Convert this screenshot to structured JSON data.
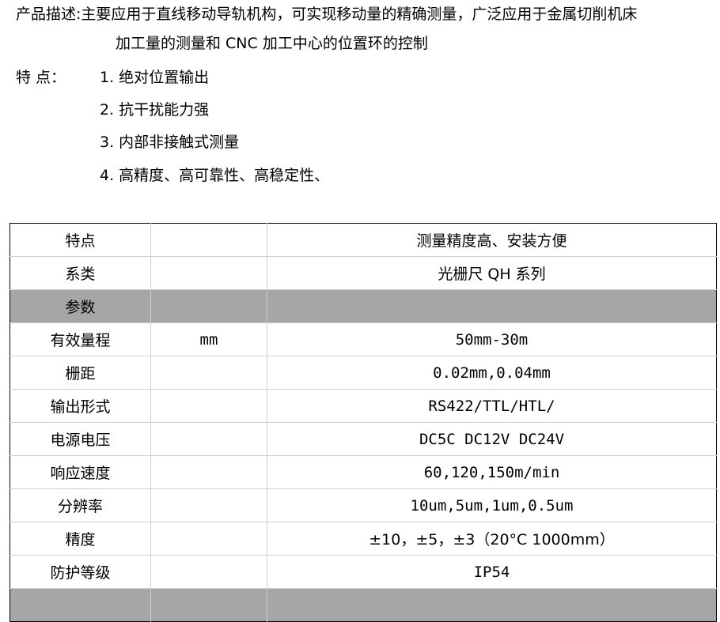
{
  "description": {
    "line1": "产品描述:主要应用于直线移动导轨机构，可实现移动量的精确测量，广泛应用于金属切削机床",
    "line2": "加工量的测量和 CNC 加工中心的位置环的控制"
  },
  "features": {
    "label": "特    点：",
    "items": [
      "1. 绝对位置输出",
      "2. 抗干扰能力强",
      "3. 内部非接触式测量",
      "4. 高精度、高可靠性、高稳定性、"
    ]
  },
  "table": {
    "rows": [
      {
        "name": "特点",
        "unit": "",
        "value": "测量精度高、安装方便"
      },
      {
        "name": "系类",
        "unit": "",
        "value": "光栅尺 QH 系列"
      },
      {
        "name": "参数",
        "unit": "",
        "value": ""
      },
      {
        "name": "有效量程",
        "unit": "mm",
        "value": "50mm-30m"
      },
      {
        "name": "栅距",
        "unit": "",
        "value": "0.02mm,0.04mm"
      },
      {
        "name": "输出形式",
        "unit": "",
        "value": "RS422/TTL/HTL/"
      },
      {
        "name": "电源电压",
        "unit": "",
        "value": "DC5C DC12V DC24V"
      },
      {
        "name": "响应速度",
        "unit": "",
        "value": "60,120,150m/min"
      },
      {
        "name": "分辨率",
        "unit": "",
        "value": "10um,5um,1um,0.5um"
      },
      {
        "name": "精度",
        "unit": "",
        "value": "±10，±5，±3（20°C 1000mm）"
      },
      {
        "name": "防护等级",
        "unit": "",
        "value": "IP54"
      },
      {
        "name": "",
        "unit": "",
        "value": ""
      }
    ]
  }
}
